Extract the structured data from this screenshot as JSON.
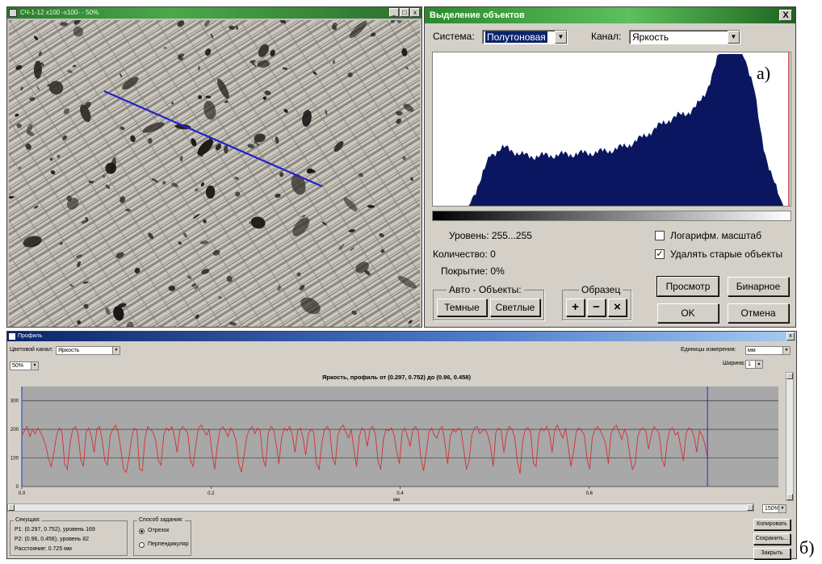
{
  "image_window": {
    "title": "СЧ-1-12 x100 -x100- - 50%",
    "buttons": [
      "_",
      "□",
      "x"
    ],
    "profile_line_color": "#2222cc"
  },
  "dialog": {
    "title": "Выделение объектов",
    "close_label": "X",
    "system_label": "Система:",
    "system_value": "Полутоновая",
    "channel_label": "Канал:",
    "channel_value": "Яркость",
    "histogram_color": "#0b1660",
    "histogram_marker_color": "#c83232",
    "level_text": "Уровень: 255...255",
    "count_text": "Количество: 0",
    "coverage_text": "Покрытие: 0%",
    "log_scale_label": "Логарифм. масштаб",
    "log_scale_checked": false,
    "delete_old_label": "Удалять старые объекты",
    "delete_old_checked": true,
    "auto_group_label": "Авто - Объекты:",
    "dark_label": "Темные",
    "light_label": "Светлые",
    "sample_group_label": "Образец",
    "sample_buttons": [
      "+",
      "−",
      "×"
    ],
    "preview_label": "Просмотр",
    "binary_label": "Бинарное",
    "ok_label": "OK",
    "cancel_label": "Отмена"
  },
  "panel_labels": {
    "a": "а)",
    "b": "б)"
  },
  "profile_window": {
    "title": "Профиль",
    "close_label": "x",
    "color_channel_label": "Цветовой канал:",
    "color_channel_value": "Яркость",
    "zoom_value": "50%",
    "units_label": "Единицы измерения:",
    "units_value": "мм",
    "width_label": "Ширина:",
    "width_value": "1",
    "zoom_bottom": "150%",
    "section_group_label": "Секущая:",
    "p1_text": "P1: (0.297, 0.752), уровень 169",
    "p2_text": "P2: (0.96, 0.458), уровень 82",
    "distance_text": "Расстояние: 0.725 мм",
    "mode_group_label": "Способ задания:",
    "mode_segment": "Отрезок",
    "mode_perpendicular": "Перпендикуляр",
    "copy_label": "Копировать",
    "save_label": "Сохранить...",
    "close_btn_label": "Закрыть"
  },
  "chart_data": {
    "type": "line",
    "title": "Яркость, профиль от (0.297, 0.752) до (0.96, 0.458)",
    "xlabel": "мм",
    "ylabel": "",
    "xlim": [
      0,
      0.8
    ],
    "ylim": [
      0,
      350
    ],
    "xticks": [
      "0.0",
      "0.2",
      "0.4",
      "0.6"
    ],
    "yticks": [
      "0",
      "100",
      "200",
      "300"
    ],
    "grid": true,
    "background": "#a8a8a8",
    "line_color": "#d23030",
    "marker_color": "#1f2fd0",
    "markers_x": [
      0.0,
      0.725
    ],
    "series": [
      {
        "x_start": 0.0,
        "x_end": 0.725,
        "values": [
          180,
          195,
          210,
          175,
          200,
          185,
          205,
          190,
          170,
          140,
          95,
          70,
          120,
          180,
          205,
          190,
          80,
          60,
          150,
          200,
          210,
          185,
          95,
          70,
          190,
          205,
          175,
          120,
          200,
          210,
          165,
          90,
          75,
          180,
          200,
          215,
          190,
          130,
          60,
          50,
          100,
          170,
          205,
          195,
          60,
          55,
          170,
          210,
          200,
          190,
          160,
          90,
          75,
          180,
          205,
          195,
          210,
          175,
          120,
          195,
          210,
          200,
          185,
          90,
          70,
          150,
          205,
          215,
          195,
          180,
          200,
          120,
          60,
          140,
          200,
          210,
          195,
          175,
          205,
          190,
          160,
          80,
          50,
          110,
          175,
          200,
          210,
          185,
          205,
          195,
          100,
          70,
          185,
          210,
          200,
          150,
          80,
          170,
          205,
          195,
          210,
          180,
          120,
          195,
          205,
          170,
          110,
          185,
          200,
          190,
          80,
          60,
          150,
          200,
          210,
          195,
          100,
          75,
          180,
          205,
          215,
          190,
          170,
          200,
          130,
          70,
          175,
          205,
          195,
          140,
          200,
          210,
          185,
          90,
          60,
          165,
          200,
          195,
          205,
          180,
          120,
          80,
          190,
          205,
          175,
          140,
          200,
          210,
          195,
          100,
          55,
          120,
          190,
          205,
          180,
          170,
          200,
          210,
          150,
          80,
          175,
          200,
          190,
          205,
          195,
          130,
          60,
          90,
          180,
          205,
          210,
          185,
          195,
          200,
          180,
          140,
          70,
          190,
          205,
          195,
          120,
          185,
          210,
          200,
          175,
          90,
          45,
          160,
          200,
          205,
          190,
          80,
          70,
          180,
          205,
          195,
          210,
          185,
          120,
          200,
          215,
          190,
          170,
          205,
          140,
          70,
          120,
          190,
          205,
          195,
          180,
          100,
          60,
          170,
          200,
          210,
          195,
          175,
          150,
          80,
          185,
          205,
          215,
          190,
          165,
          200,
          180,
          110,
          60,
          80,
          175,
          200,
          205,
          195,
          130,
          180,
          210,
          200,
          185,
          95,
          70,
          160,
          200,
          205,
          180,
          190,
          140,
          90,
          185,
          205,
          200,
          175,
          120,
          195,
          180,
          150,
          100
        ]
      }
    ]
  }
}
